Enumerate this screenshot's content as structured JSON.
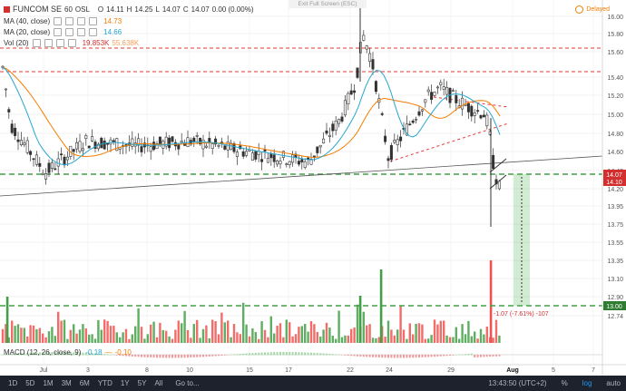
{
  "symbol": {
    "name": "FUNCOM SE",
    "interval": "60",
    "exchange": "OSL",
    "ohlc": {
      "O": "14.11",
      "H": "14.25",
      "L": "14.07",
      "C": "14.07",
      "change": "0.00 (0.00%)"
    },
    "color": "#d32f2f"
  },
  "indicators": [
    {
      "label": "MA (40, close)",
      "value": "14.73",
      "color": "#f57c00"
    },
    {
      "label": "MA (20, close)",
      "value": "14.66",
      "color": "#26a6d1"
    },
    {
      "label": "Vol (20)",
      "value": "19.853K",
      "value2": "55.638K",
      "color": "#d32f2f",
      "color2": "#f5a05a"
    }
  ],
  "macd": {
    "label": "MACD (12, 26, close, 9)",
    "v1": "-0.18",
    "v2": "-0.10",
    "v2_prefix": "—",
    "color1": "#26a6d1",
    "color2": "#f57c00"
  },
  "exit_fullscreen": "Exit Full Screen (ESC)",
  "delayed": "Delayed",
  "price_axis": {
    "labels": [
      "16.00",
      "15.80",
      "15.60",
      "15.40",
      "15.20",
      "15.00",
      "14.80",
      "14.60",
      "14.40",
      "14.20",
      "13.95",
      "13.75",
      "13.55",
      "13.35",
      "13.10",
      "12.90",
      "12.74"
    ],
    "markers": [
      {
        "label": "14.07",
        "color": "#d32f2f"
      },
      {
        "label": "14.10",
        "color": "#d32f2f"
      },
      {
        "label": "13.00",
        "color": "#2e7d32"
      }
    ]
  },
  "time_axis": {
    "labels": [
      "Jul",
      "3",
      "8",
      "10",
      "15",
      "17",
      "22",
      "24",
      "29",
      "Aug",
      "5",
      "7"
    ],
    "highlight": "Aug"
  },
  "measure_label": "-1.07 (-7.61%) -107",
  "bottom": {
    "ranges": [
      "1D",
      "5D",
      "1M",
      "3M",
      "6M",
      "YTD",
      "1Y",
      "5Y",
      "All",
      "Go to..."
    ],
    "time": "13:43:50 (UTC+2)",
    "toggles": [
      "%",
      "log",
      "auto"
    ]
  }
}
